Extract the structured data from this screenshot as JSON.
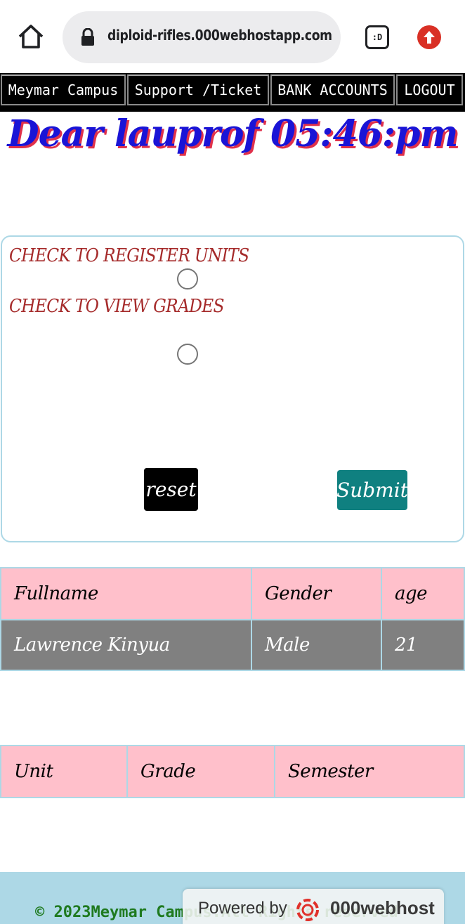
{
  "browser": {
    "url": "diploid-rifles.000webhostapp.com",
    "tab_switcher_label": ":D"
  },
  "nav": {
    "items": [
      {
        "label": "Meymar Campus"
      },
      {
        "label": "Support /Ticket"
      },
      {
        "label": "BANK ACCOUNTS"
      },
      {
        "label": "LOGOUT"
      }
    ]
  },
  "greeting": "Dear lauprof 05:46:pm",
  "form": {
    "register_label": "CHECK TO REGISTER UNITS",
    "grades_label": "CHECK TO VIEW GRADES",
    "reset_label": "reset",
    "submit_label": "Submit"
  },
  "student_table": {
    "headers": [
      "Fullname",
      "Gender",
      "age"
    ],
    "rows": [
      [
        "Lawrence Kinyua",
        "Male",
        "21"
      ]
    ]
  },
  "grades_table": {
    "headers": [
      "Unit",
      "Grade",
      "Semester"
    ]
  },
  "footer": {
    "copyright": "© 2023Meymar Campus:All Rights reserved",
    "powered_prefix": "Powered by",
    "powered_brand": "000webhost"
  },
  "colors": {
    "greeting": "#1a14d6",
    "greeting_shadow": "#e0314b",
    "form_label": "#a52a2a",
    "submit_bg": "#0f8080",
    "table_header_bg": "#ffc0cb",
    "table_row_bg": "#808080",
    "footer_bg": "#add8e6",
    "footer_text": "#1f7a1f"
  }
}
